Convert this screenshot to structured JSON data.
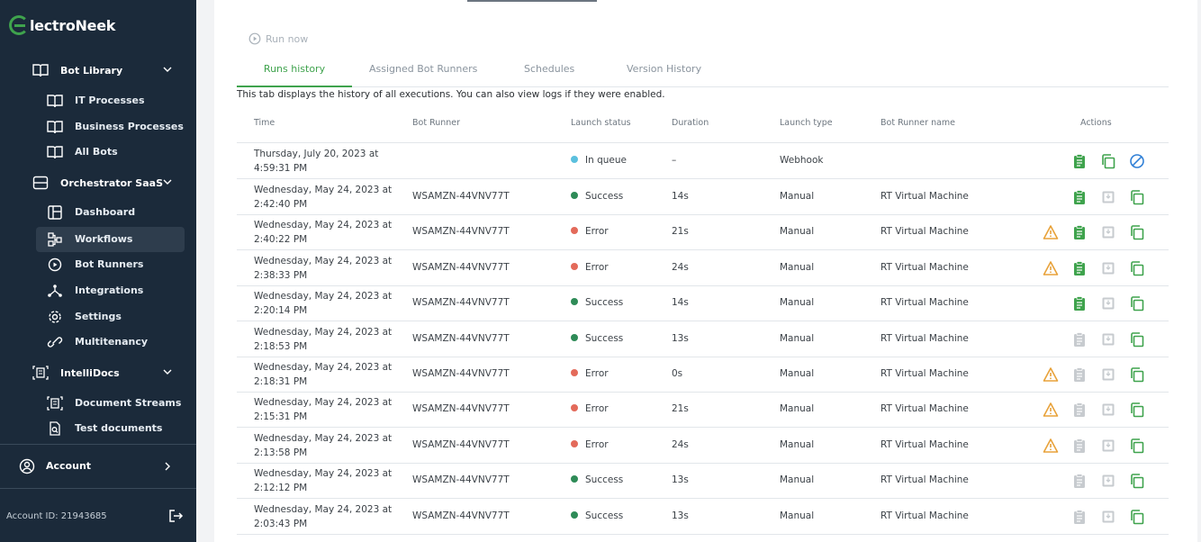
{
  "brand": {
    "name": "lectroNeek"
  },
  "sidebar": {
    "sections": [
      {
        "label": "Bot Library",
        "icon": "book-icon"
      },
      {
        "label": "Orchestrator SaaS",
        "icon": "server-icon"
      },
      {
        "label": "IntelliDocs",
        "icon": "document-scan-icon"
      }
    ],
    "items": [
      {
        "label": "IT Processes",
        "icon": "book-icon"
      },
      {
        "label": "Business Processes",
        "icon": "book-icon"
      },
      {
        "label": "All Bots",
        "icon": "book-icon"
      },
      {
        "label": "Dashboard",
        "icon": "dashboard-icon"
      },
      {
        "label": "Workflows",
        "icon": "workflow-icon"
      },
      {
        "label": "Bot Runners",
        "icon": "play-circle-icon"
      },
      {
        "label": "Integrations",
        "icon": "integrations-icon"
      },
      {
        "label": "Settings",
        "icon": "gear-icon"
      },
      {
        "label": "Multitenancy",
        "icon": "link-icon"
      },
      {
        "label": "Document Streams",
        "icon": "document-scan-icon"
      },
      {
        "label": "Test documents",
        "icon": "search-document-icon"
      }
    ],
    "account": "Account",
    "account_id": "Account ID: 21943685"
  },
  "main": {
    "run_now": "Run now",
    "tabs": [
      {
        "label": "Runs history",
        "active": true
      },
      {
        "label": "Assigned Bot Runners",
        "active": false
      },
      {
        "label": "Schedules",
        "active": false
      },
      {
        "label": "Version History",
        "active": false
      }
    ],
    "description": "This tab displays the history of all executions. You can also view logs if they were enabled.",
    "columns": [
      "Time",
      "Bot Runner",
      "Launch status",
      "Duration",
      "Launch type",
      "Bot Runner name",
      "Actions"
    ],
    "rows": [
      {
        "time1": "Thursday, July 20, 2023 at",
        "time2": "4:59:31 PM",
        "runner": "",
        "status": "In queue",
        "duration": "–",
        "type": "Webhook",
        "runner_name": ""
      },
      {
        "time1": "Wednesday, May 24, 2023 at",
        "time2": "2:42:40 PM",
        "runner": "WSAMZN-44VNV77T",
        "status": "Success",
        "duration": "14s",
        "type": "Manual",
        "runner_name": "RT Virtual Machine"
      },
      {
        "time1": "Wednesday, May 24, 2023 at",
        "time2": "2:40:22 PM",
        "runner": "WSAMZN-44VNV77T",
        "status": "Error",
        "duration": "21s",
        "type": "Manual",
        "runner_name": "RT Virtual Machine"
      },
      {
        "time1": "Wednesday, May 24, 2023 at",
        "time2": "2:38:33 PM",
        "runner": "WSAMZN-44VNV77T",
        "status": "Error",
        "duration": "24s",
        "type": "Manual",
        "runner_name": "RT Virtual Machine"
      },
      {
        "time1": "Wednesday, May 24, 2023 at",
        "time2": "2:20:14 PM",
        "runner": "WSAMZN-44VNV77T",
        "status": "Success",
        "duration": "14s",
        "type": "Manual",
        "runner_name": "RT Virtual Machine"
      },
      {
        "time1": "Wednesday, May 24, 2023 at",
        "time2": "2:18:53 PM",
        "runner": "WSAMZN-44VNV77T",
        "status": "Success",
        "duration": "13s",
        "type": "Manual",
        "runner_name": "RT Virtual Machine"
      },
      {
        "time1": "Wednesday, May 24, 2023 at",
        "time2": "2:18:31 PM",
        "runner": "WSAMZN-44VNV77T",
        "status": "Error",
        "duration": "0s",
        "type": "Manual",
        "runner_name": "RT Virtual Machine"
      },
      {
        "time1": "Wednesday, May 24, 2023 at",
        "time2": "2:15:31 PM",
        "runner": "WSAMZN-44VNV77T",
        "status": "Error",
        "duration": "21s",
        "type": "Manual",
        "runner_name": "RT Virtual Machine"
      },
      {
        "time1": "Wednesday, May 24, 2023 at",
        "time2": "2:13:58 PM",
        "runner": "WSAMZN-44VNV77T",
        "status": "Error",
        "duration": "24s",
        "type": "Manual",
        "runner_name": "RT Virtual Machine"
      },
      {
        "time1": "Wednesday, May 24, 2023 at",
        "time2": "2:12:12 PM",
        "runner": "WSAMZN-44VNV77T",
        "status": "Success",
        "duration": "13s",
        "type": "Manual",
        "runner_name": "RT Virtual Machine"
      },
      {
        "time1": "Wednesday, May 24, 2023 at",
        "time2": "2:03:43 PM",
        "runner": "WSAMZN-44VNV77T",
        "status": "Success",
        "duration": "13s",
        "type": "Manual",
        "runner_name": "RT Virtual Machine"
      }
    ]
  },
  "colors": {
    "accent": "#3fa34d",
    "status_success": "#2e8b57",
    "status_error": "#e36a5a",
    "status_queue": "#5bc0de",
    "warning": "#e8a23a",
    "cancel": "#2f7fd6",
    "disabled": "#c7cbcf"
  }
}
